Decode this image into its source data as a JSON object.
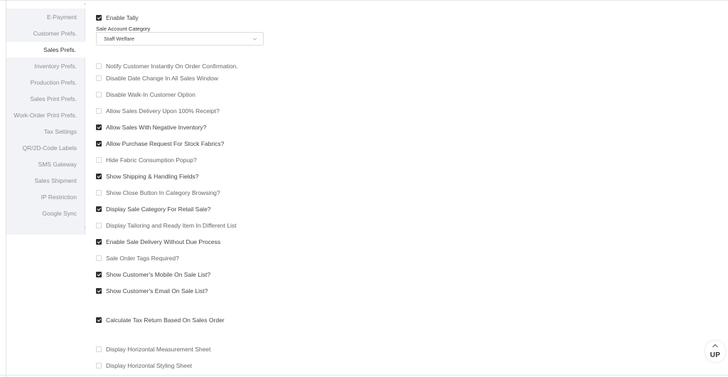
{
  "sidebar": {
    "items": [
      {
        "label": "E-Payment",
        "active": false
      },
      {
        "label": "Customer Prefs.",
        "active": false
      },
      {
        "label": "Sales Prefs.",
        "active": true
      },
      {
        "label": "Inventory Prefs.",
        "active": false
      },
      {
        "label": "Production Prefs.",
        "active": false
      },
      {
        "label": "Sales Print Prefs.",
        "active": false
      },
      {
        "label": "Work-Order Print Prefs.",
        "active": false
      },
      {
        "label": "Tax Settings",
        "active": false
      },
      {
        "label": "QR/2D-Code Labels",
        "active": false
      },
      {
        "label": "SMS Gateway",
        "active": false
      },
      {
        "label": "Sales Shipment",
        "active": false
      },
      {
        "label": "IP Restriction",
        "active": false
      },
      {
        "label": "Google Sync",
        "active": false
      }
    ]
  },
  "enable_tally": {
    "label": "Enable Tally",
    "checked": true
  },
  "sale_account_category": {
    "label": "Sale Account Category",
    "value": "Staff Welfare",
    "icon": "chevron-down-icon"
  },
  "options": [
    {
      "label": "Notify Customer Instantly On Order Confirmation.",
      "checked": false
    },
    {
      "label": "Disable Date Change In All Sales Window",
      "checked": false
    },
    {
      "label": "Disable Walk-In Customer Option",
      "checked": false
    },
    {
      "label": "Allow Sales Delivery Upon 100% Receipt?",
      "checked": false
    },
    {
      "label": "Allow Sales With Negative Inventory?",
      "checked": true
    },
    {
      "label": "Allow Purchase Request For Stock Fabrics?",
      "checked": true
    },
    {
      "label": "Hide Fabric Consumption Popup?",
      "checked": false
    },
    {
      "label": "Show Shipping & Handling Fields?",
      "checked": true
    },
    {
      "label": "Show Close Button In Category Browsing?",
      "checked": false
    },
    {
      "label": "Display Sale Category For Retail Sale?",
      "checked": true
    },
    {
      "label": "Display Tailoring and Ready Item In Different List",
      "checked": false
    },
    {
      "label": "Enable Sale Delivery Without Due Process",
      "checked": true
    },
    {
      "label": "Sale Order Tags Required?",
      "checked": false
    },
    {
      "label": "Show Customer's Mobile On Sale List?",
      "checked": true
    },
    {
      "label": "Show Customer's Email On Sale List?",
      "checked": true
    },
    {
      "label": "Calculate Tax Return Based On Sales Order",
      "checked": true
    },
    {
      "label": "Display Horizontal Measurement Sheet",
      "checked": false
    },
    {
      "label": "Display Horizontal Styling Sheet",
      "checked": false
    }
  ],
  "scroll_up": {
    "label": "UP",
    "icon": "chevron-up-icon"
  },
  "colors": {
    "checked": "#2f2f2f",
    "sidebar_bg": "#f2f3f7",
    "muted_text": "#8b8d98"
  }
}
